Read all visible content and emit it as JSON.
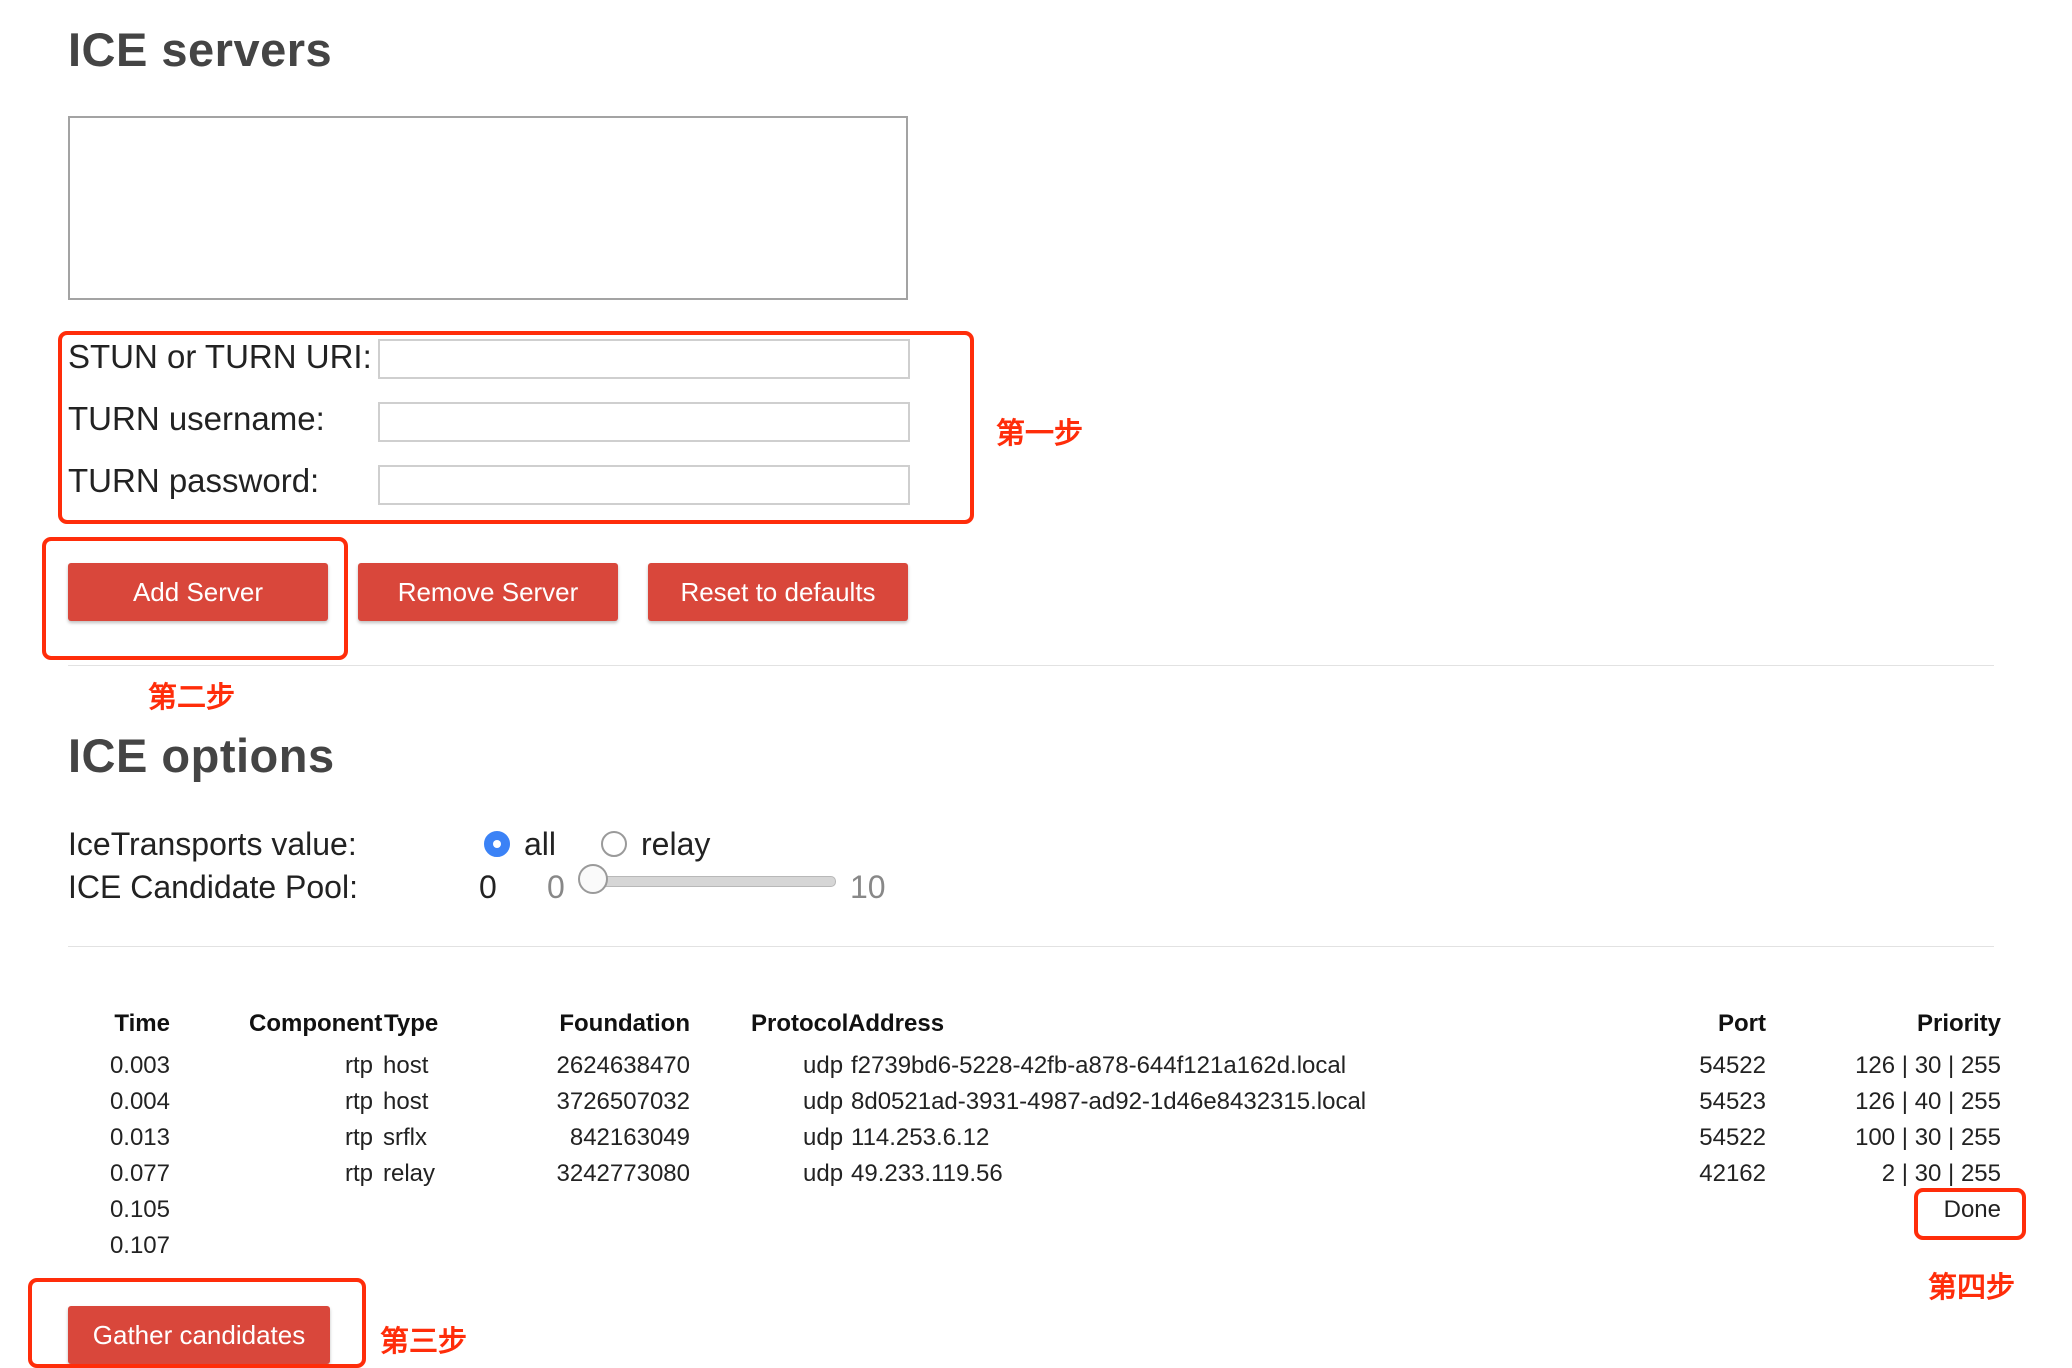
{
  "servers_section": {
    "title": "ICE servers",
    "fields": [
      {
        "label": "STUN or TURN URI:",
        "value": ""
      },
      {
        "label": "TURN username:",
        "value": ""
      },
      {
        "label": "TURN password:",
        "value": ""
      }
    ],
    "buttons": {
      "add": "Add Server",
      "remove": "Remove Server",
      "reset": "Reset to defaults"
    }
  },
  "options_section": {
    "title": "ICE options",
    "ice_transports_label": "IceTransports value:",
    "radio_all": "all",
    "radio_relay": "relay",
    "selected_transport": "all",
    "pool_label": "ICE Candidate Pool:",
    "pool_value": "0",
    "pool_min": "0",
    "pool_max": "10"
  },
  "candidates_table": {
    "headers": [
      "Time",
      "Component",
      "Type",
      "Foundation",
      "Protocol",
      "Address",
      "Port",
      "Priority"
    ],
    "rows": [
      {
        "time": "0.003",
        "component": "rtp",
        "type": "host",
        "foundation": "2624638470",
        "protocol": "udp",
        "address": "f2739bd6-5228-42fb-a878-644f121a162d.local",
        "port": "54522",
        "priority": "126 | 30 | 255"
      },
      {
        "time": "0.004",
        "component": "rtp",
        "type": "host",
        "foundation": "3726507032",
        "protocol": "udp",
        "address": "8d0521ad-3931-4987-ad92-1d46e8432315.local",
        "port": "54523",
        "priority": "126 | 40 | 255"
      },
      {
        "time": "0.013",
        "component": "rtp",
        "type": "srflx",
        "foundation": "842163049",
        "protocol": "udp",
        "address": "114.253.6.12",
        "port": "54522",
        "priority": "100 | 30 | 255"
      },
      {
        "time": "0.077",
        "component": "rtp",
        "type": "relay",
        "foundation": "3242773080",
        "protocol": "udp",
        "address": "49.233.119.56",
        "port": "42162",
        "priority": "2 | 30 | 255"
      },
      {
        "time": "0.105",
        "component": "",
        "type": "",
        "foundation": "",
        "protocol": "",
        "address": "",
        "port": "",
        "priority": "Done"
      },
      {
        "time": "0.107",
        "component": "",
        "type": "",
        "foundation": "",
        "protocol": "",
        "address": "",
        "port": "",
        "priority": ""
      }
    ]
  },
  "gather_button": "Gather candidates",
  "annotations": {
    "step1": "第一步",
    "step2": "第二步",
    "step3": "第三步",
    "step4": "第四步",
    "color": "#ff2d0a"
  },
  "colors": {
    "button": "#d9473b",
    "radio_selected": "#3b82f6"
  }
}
